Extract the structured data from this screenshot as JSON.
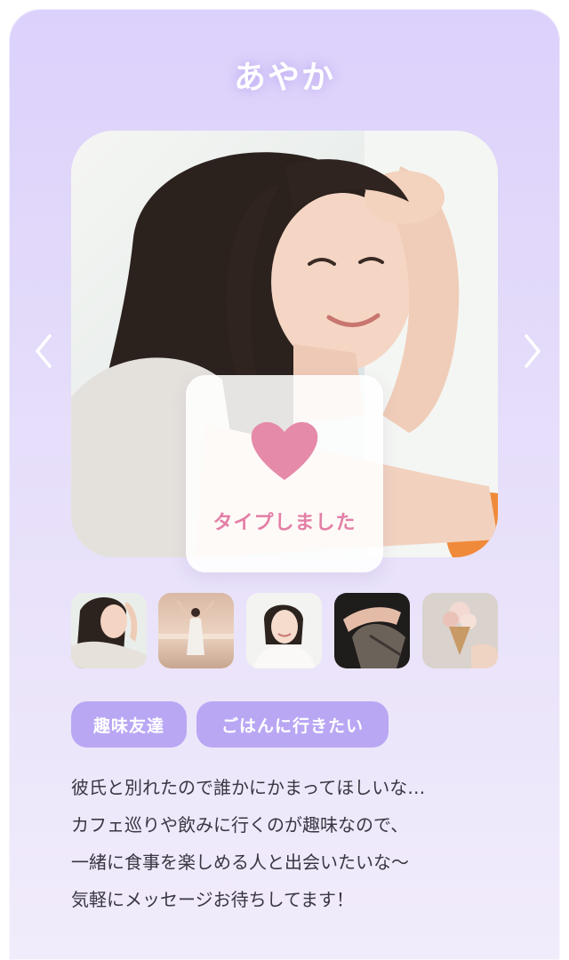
{
  "profile": {
    "name": "あやか",
    "like_overlay_text": "タイプしました",
    "tags": [
      "趣味友達",
      "ごはんに行きたい"
    ],
    "bio_lines": [
      "彼氏と別れたので誰かにかまってほしいな…",
      "カフェ巡りや飲みに行くのが趣味なので、",
      "一緒に食事を楽しめる人と出会いたいな〜",
      "気軽にメッセージお待ちしてます！"
    ]
  },
  "icons": {
    "prev": "chevron-left-icon",
    "next": "chevron-right-icon",
    "like": "heart-icon"
  },
  "colors": {
    "card_background": "#dcd1fb",
    "tag_background": "#b9a7f4",
    "heart": "#e47fa6",
    "text": "#3a3642"
  }
}
